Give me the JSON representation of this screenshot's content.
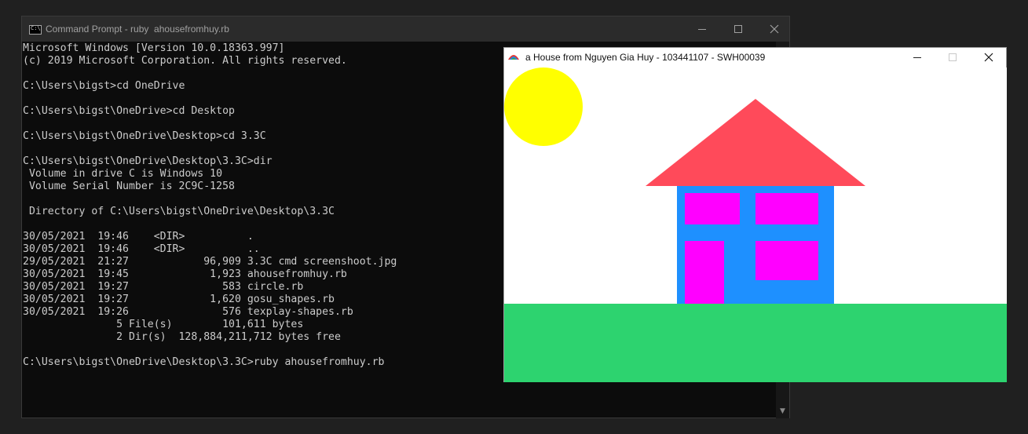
{
  "cmd": {
    "title": "Command Prompt - ruby  ahousefromhuy.rb",
    "lines": [
      "Microsoft Windows [Version 10.0.18363.997]",
      "(c) 2019 Microsoft Corporation. All rights reserved.",
      "",
      "C:\\Users\\bigst>cd OneDrive",
      "",
      "C:\\Users\\bigst\\OneDrive>cd Desktop",
      "",
      "C:\\Users\\bigst\\OneDrive\\Desktop>cd 3.3C",
      "",
      "C:\\Users\\bigst\\OneDrive\\Desktop\\3.3C>dir",
      " Volume in drive C is Windows 10",
      " Volume Serial Number is 2C9C-1258",
      "",
      " Directory of C:\\Users\\bigst\\OneDrive\\Desktop\\3.3C",
      "",
      "30/05/2021  19:46    <DIR>          .",
      "30/05/2021  19:46    <DIR>          ..",
      "29/05/2021  21:27            96,909 3.3C cmd screenshoot.jpg",
      "30/05/2021  19:45             1,923 ahousefromhuy.rb",
      "30/05/2021  19:27               583 circle.rb",
      "30/05/2021  19:27             1,620 gosu_shapes.rb",
      "30/05/2021  19:26               576 texplay-shapes.rb",
      "               5 File(s)        101,611 bytes",
      "               2 Dir(s)  128,884,211,712 bytes free",
      "",
      "C:\\Users\\bigst\\OneDrive\\Desktop\\3.3C>ruby ahousefromhuy.rb"
    ],
    "icons": {
      "app": "command-prompt-icon",
      "minimize": "minimize-icon",
      "maximize": "maximize-icon",
      "close": "close-icon",
      "scroll_down": "scroll-down-arrow-icon"
    }
  },
  "house_window": {
    "title": "a House from Nguyen Gia Huy - 103441107 - SWH00039",
    "icons": {
      "app": "gosu-app-icon",
      "minimize": "minimize-icon",
      "maximize": "maximize-icon",
      "close": "close-icon"
    },
    "colors": {
      "background": "#ffffff",
      "sun": "#ffff00",
      "roof": "#ff4a5a",
      "house_body": "#1e90ff",
      "windows_and_door": "#ff00ff",
      "ground": "#2dd36f"
    }
  },
  "desktop": {
    "background": "#202020"
  }
}
